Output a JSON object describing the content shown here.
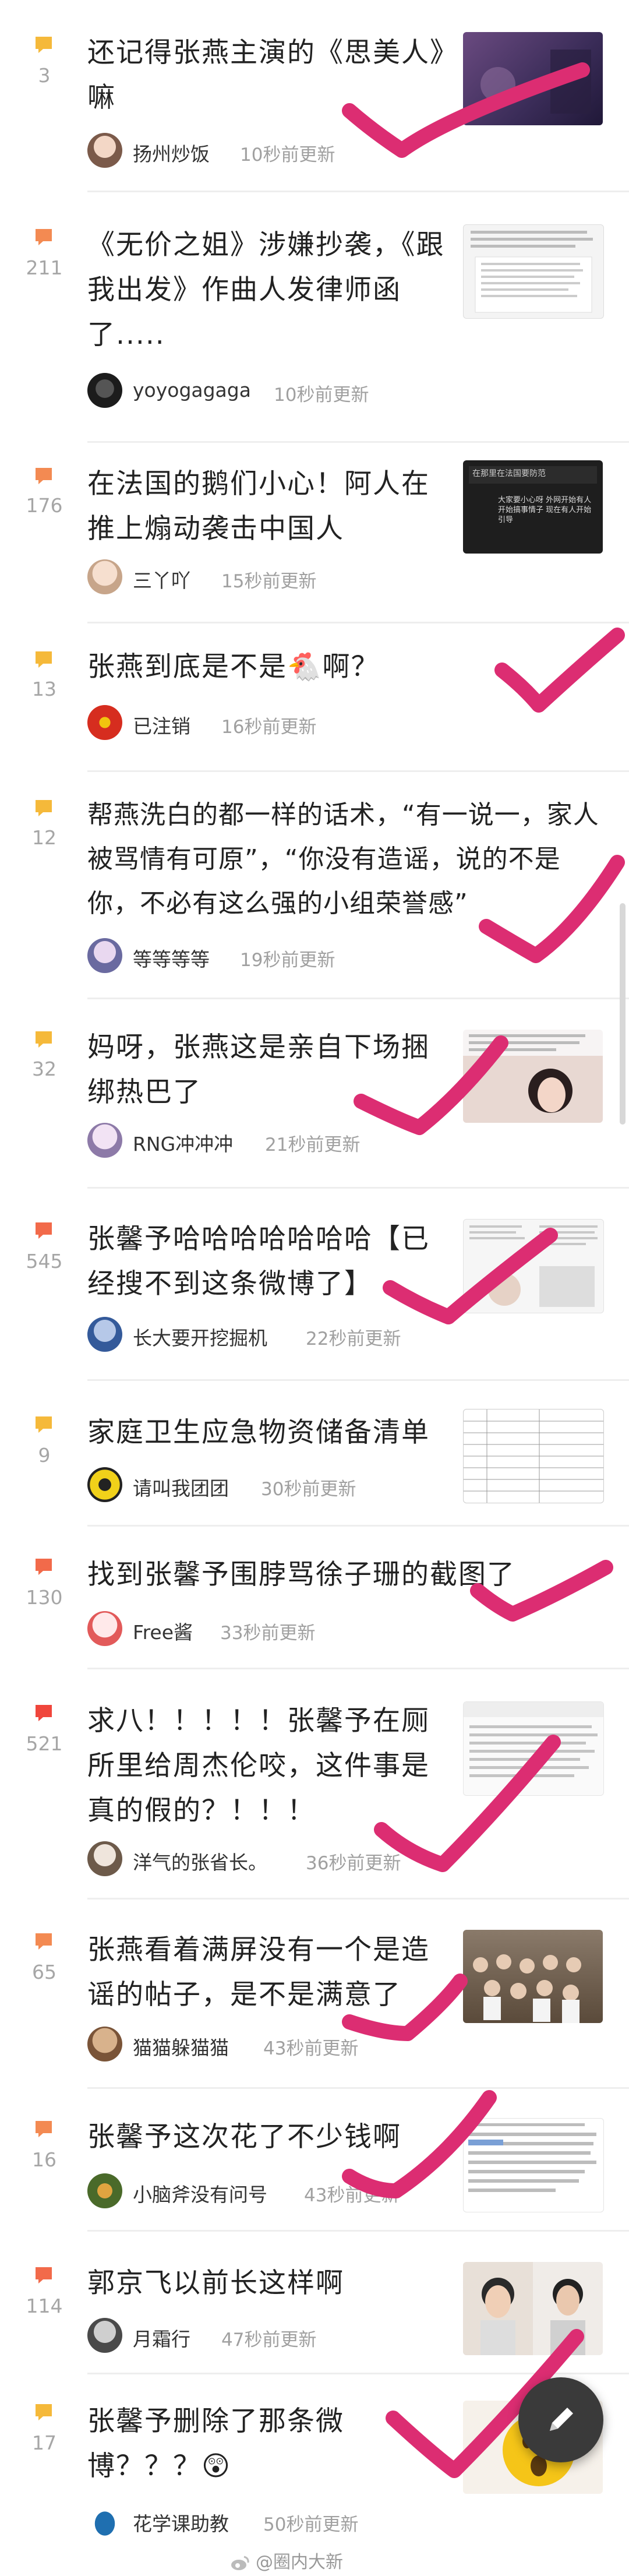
{
  "posts": [
    {
      "title": "还记得张燕主演的《思美人》嘛",
      "count": "3",
      "username": "扬州炒饭",
      "time": "10秒前更新"
    },
    {
      "title": "《无价之姐》涉嫌抄袭，《跟我出发》作曲人发律师函了.....",
      "count": "211",
      "username": "yoyogagaga",
      "time": "10秒前更新"
    },
    {
      "title": "在法国的鹅们小心！阿人在推上煽动袭击中国人",
      "count": "176",
      "username": "三丫吖",
      "time": "15秒前更新"
    },
    {
      "title": "张燕到底是不是🐔啊？",
      "count": "13",
      "username": "已注销",
      "time": "16秒前更新"
    },
    {
      "title": "帮燕洗白的都一样的话术，“有一说一，家人被骂情有可原”，“你没有造谣，说的不是你，不必有这么强的小组荣誉感”",
      "count": "12",
      "username": "等等等等",
      "time": "19秒前更新"
    },
    {
      "title": "妈呀，张燕这是亲自下场捆绑热巴了",
      "count": "32",
      "username": "RNG冲冲冲",
      "time": "21秒前更新"
    },
    {
      "title": "张馨予哈哈哈哈哈哈哈【已经搜不到这条微博了】",
      "count": "545",
      "username": "长大要开挖掘机",
      "time": "22秒前更新"
    },
    {
      "title": "家庭卫生应急物资储备清单",
      "count": "9",
      "username": "请叫我团团",
      "time": "30秒前更新"
    },
    {
      "title": "找到张馨予围脖骂徐子珊的截图了",
      "count": "130",
      "username": "Free酱",
      "time": "33秒前更新"
    },
    {
      "title": "求八！！！！！张馨予在厕所里给周杰伦咬，这件事是真的假的？！！！",
      "count": "521",
      "username": "洋气的张省长。",
      "time": "36秒前更新"
    },
    {
      "title": "张燕看着满屏没有一个是造谣的帖子，是不是满意了",
      "count": "65",
      "username": "猫猫躲猫猫",
      "time": "43秒前更新"
    },
    {
      "title": "张馨予这次花了不少钱啊",
      "count": "16",
      "username": "小脑斧没有问号",
      "time": "43秒前更新"
    },
    {
      "title": "郭京飞以前长这样啊",
      "count": "114",
      "username": "月霜行",
      "time": "47秒前更新"
    },
    {
      "title": "张馨予删除了那条微博？？？😲",
      "count": "17",
      "username": "花学课助教",
      "time": "50秒前更新"
    }
  ],
  "thumb_texts": {
    "t3": "在那里在法国要防范",
    "t3b": "大家要小心呀 外网开始有人开始搞事情子 现在有人开始引导"
  },
  "watermark": "@圈内大新",
  "colors": {
    "accent": "#f5a04a",
    "check": "#dc2d72",
    "divider": "#eeeeee"
  },
  "icons": {
    "comment": "comment-bubble-icon",
    "fab": "pencil-icon"
  }
}
